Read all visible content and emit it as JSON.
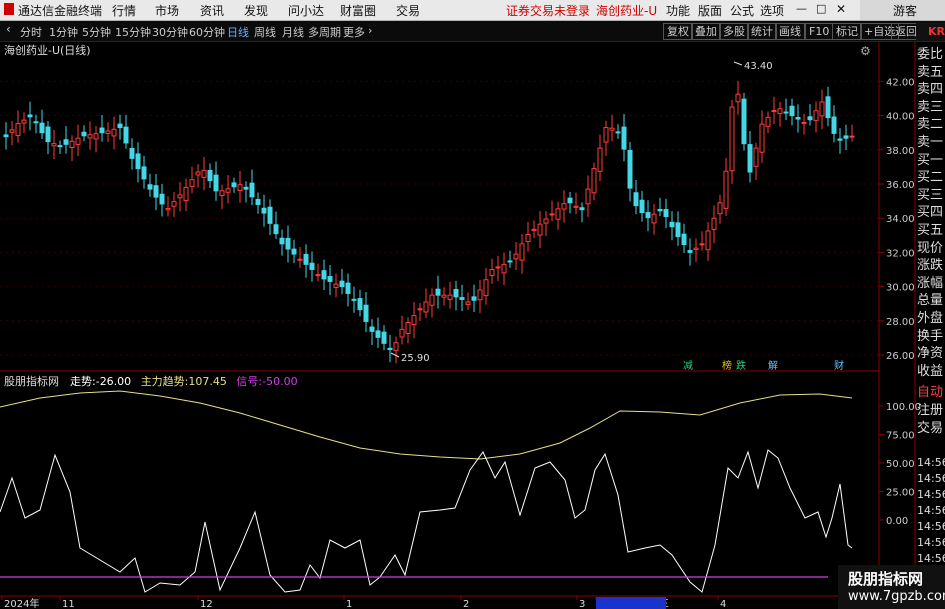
{
  "app": {
    "title": "通达信金融终端",
    "notice": "证券交易未登录",
    "stock_tab": "海创药业-U"
  },
  "menu": {
    "items": [
      "行情",
      "市场",
      "资讯",
      "发现",
      "问小达",
      "财富圈",
      "交易"
    ],
    "right": [
      "功能",
      "版面",
      "公式",
      "选项"
    ],
    "guest": "游客"
  },
  "toolbar": {
    "periods": [
      "分时",
      "1分钟",
      "5分钟",
      "15分钟",
      "30分钟",
      "60分钟",
      "日线",
      "周线",
      "月线",
      "多周期",
      "更多"
    ],
    "active_period": "日线",
    "buttons": [
      "复权",
      "叠加",
      "多股",
      "统计",
      "画线",
      "F10",
      "标记",
      "+自选",
      "返回"
    ]
  },
  "price_panel": {
    "title": "海创药业-U(日线)",
    "high_label": "43.40",
    "low_label": "25.90",
    "y_ticks": [
      "42.00",
      "40.00",
      "38.00",
      "36.00",
      "34.00",
      "32.00",
      "30.00",
      "28.00",
      "26.00"
    ],
    "event_marks": [
      {
        "text": "减",
        "color": "#20d080"
      },
      {
        "text": "榜",
        "color": "#e8c000"
      },
      {
        "text": "跌",
        "color": "#20d080"
      },
      {
        "text": "解",
        "color": "#60c0ff"
      },
      {
        "text": "财",
        "color": "#60c0ff"
      }
    ],
    "colors": {
      "up": "#ff3b3b",
      "down": "#46d7e6"
    }
  },
  "indicator_panel": {
    "name": "股朋指标网",
    "trend_label": "走势:",
    "trend_value": "-26.00",
    "main_label": "主力趋势:",
    "main_value": "107.45",
    "signal_label": "信号:",
    "signal_value": "-50.00",
    "y_ticks": [
      "100.00",
      "75.00",
      "50.00",
      "25.00",
      "0.00"
    ],
    "colors": {
      "trend": "#ffffff",
      "main": "#e6e08a",
      "signal": "#d040e0"
    }
  },
  "date_axis": {
    "labels": [
      "2024年",
      "11",
      "12",
      "1",
      "2",
      "3",
      "2025/03/05/三",
      "4"
    ]
  },
  "right_panel": {
    "top_label": "KR",
    "items": [
      "委比",
      "卖五",
      "卖四",
      "卖三",
      "卖二",
      "卖一",
      "买一",
      "买二",
      "买三",
      "买四",
      "买五",
      "现价",
      "涨跌",
      "涨幅",
      "总量",
      "外盘",
      "换手",
      "净资",
      "收益"
    ],
    "lower_items": [
      "自动",
      "注册",
      "交易"
    ],
    "times": [
      "14:56",
      "14:56",
      "14:56",
      "14:56",
      "14:56",
      "14:56",
      "14:56",
      "14:56"
    ]
  },
  "watermark": {
    "line1": "股朋指标网",
    "line2": "www.7gpzb.com"
  }
}
